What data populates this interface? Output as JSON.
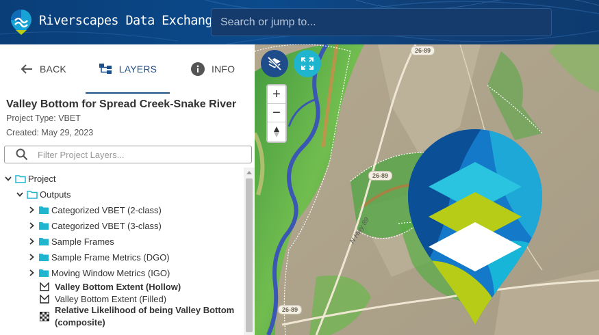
{
  "header": {
    "app_title": "Riverscapes Data Exchange",
    "search_placeholder": "Search or jump to...",
    "logo_icon": "riverscapes-logo-icon"
  },
  "panel": {
    "tabs": [
      {
        "label": "BACK",
        "icon": "arrow-left-icon"
      },
      {
        "label": "LAYERS",
        "icon": "layers-tree-icon",
        "active": true
      },
      {
        "label": "INFO",
        "icon": "info-icon"
      }
    ],
    "project_title": "Valley Bottom for Spread Creek-Snake River",
    "project_type": "Project Type: VBET",
    "created": "Created: May 29, 2023",
    "filter_placeholder": "Filter Project Layers..."
  },
  "tree": [
    {
      "label": "Project",
      "level": 0,
      "type": "folder-open",
      "expanded": true
    },
    {
      "label": "Outputs",
      "level": 1,
      "type": "folder-open",
      "expanded": true
    },
    {
      "label": "Categorized VBET (2-class)",
      "level": 2,
      "type": "folder",
      "expanded": false
    },
    {
      "label": "Categorized VBET (3-class)",
      "level": 2,
      "type": "folder",
      "expanded": false
    },
    {
      "label": "Sample Frames",
      "level": 2,
      "type": "folder",
      "expanded": false
    },
    {
      "label": "Sample Frame Metrics (DGO)",
      "level": 2,
      "type": "folder",
      "expanded": false
    },
    {
      "label": "Moving Window Metrics (IGO)",
      "level": 2,
      "type": "folder",
      "expanded": false
    },
    {
      "label": "Valley Bottom Extent (Hollow)",
      "level": 2,
      "type": "polygon-layer",
      "bold": true
    },
    {
      "label": "Valley Bottom Extent (Filled)",
      "level": 2,
      "type": "polygon-layer",
      "bold": false
    },
    {
      "label": "Relative Likelihood of being Valley Bottom",
      "label2": "(composite)",
      "level": 2,
      "type": "raster-layer",
      "bold": true
    }
  ],
  "map": {
    "road_badges": [
      "26-89",
      "26-89",
      "26-89"
    ],
    "road_label": "N Hwy 89",
    "zoom_in": "+",
    "zoom_out": "−",
    "colors": {
      "water": "#3b57b4",
      "vegetation": "#4fae3f",
      "terrain": "#b7a98c",
      "accent": "#1fb5cf",
      "brand": "#1f4c8a"
    }
  }
}
